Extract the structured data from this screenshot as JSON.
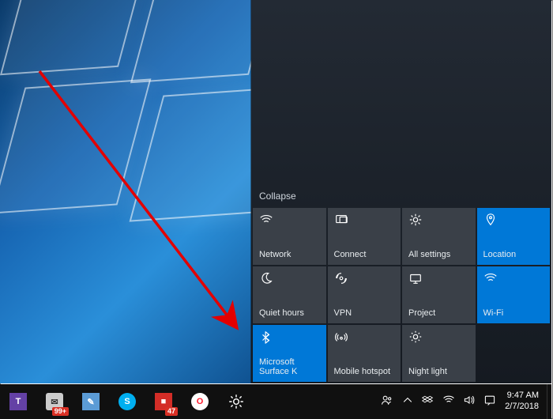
{
  "action_center": {
    "collapse_label": "Collapse",
    "tiles": [
      {
        "id": "network",
        "label": "Network",
        "icon": "wifi-icon",
        "active": false
      },
      {
        "id": "connect",
        "label": "Connect",
        "icon": "cast-icon",
        "active": false
      },
      {
        "id": "settings",
        "label": "All settings",
        "icon": "gear-icon",
        "active": false
      },
      {
        "id": "location",
        "label": "Location",
        "icon": "location-icon",
        "active": true
      },
      {
        "id": "quiet",
        "label": "Quiet hours",
        "icon": "moon-icon",
        "active": false
      },
      {
        "id": "vpn",
        "label": "VPN",
        "icon": "vpn-icon",
        "active": false
      },
      {
        "id": "project",
        "label": "Project",
        "icon": "project-icon",
        "active": false
      },
      {
        "id": "wifi",
        "label": "Wi-Fi",
        "icon": "wifi-icon",
        "active": true
      },
      {
        "id": "bt",
        "label": "Microsoft Surface K",
        "icon": "bluetooth-icon",
        "active": true
      },
      {
        "id": "hotspot",
        "label": "Mobile hotspot",
        "icon": "hotspot-icon",
        "active": false
      },
      {
        "id": "night",
        "label": "Night light",
        "icon": "brightness-icon",
        "active": false
      }
    ]
  },
  "taskbar": {
    "left": [
      {
        "id": "twitch",
        "icon": "twitch-icon",
        "badge": ""
      },
      {
        "id": "msgs",
        "icon": "folder-icon",
        "badge": "99+"
      },
      {
        "id": "onenote",
        "icon": "note-icon",
        "badge": ""
      },
      {
        "id": "skype",
        "icon": "skype-icon",
        "badge": ""
      },
      {
        "id": "lastpass",
        "icon": "lastpass-icon",
        "badge": "47"
      },
      {
        "id": "opera",
        "icon": "opera-icon",
        "badge": ""
      },
      {
        "id": "settings",
        "icon": "gear-icon",
        "badge": ""
      }
    ],
    "tray": [
      {
        "id": "people",
        "icon": "people-icon"
      },
      {
        "id": "chevron",
        "icon": "chevron-up-icon"
      },
      {
        "id": "dropbox",
        "icon": "dropbox-icon"
      },
      {
        "id": "wifi",
        "icon": "wifi-icon"
      },
      {
        "id": "volume",
        "icon": "volume-icon"
      },
      {
        "id": "notif",
        "icon": "notif-icon"
      }
    ],
    "clock": {
      "time": "9:47 AM",
      "date": "2/7/2018"
    }
  },
  "annotation": {
    "kind": "arrow",
    "color": "#e30000"
  }
}
